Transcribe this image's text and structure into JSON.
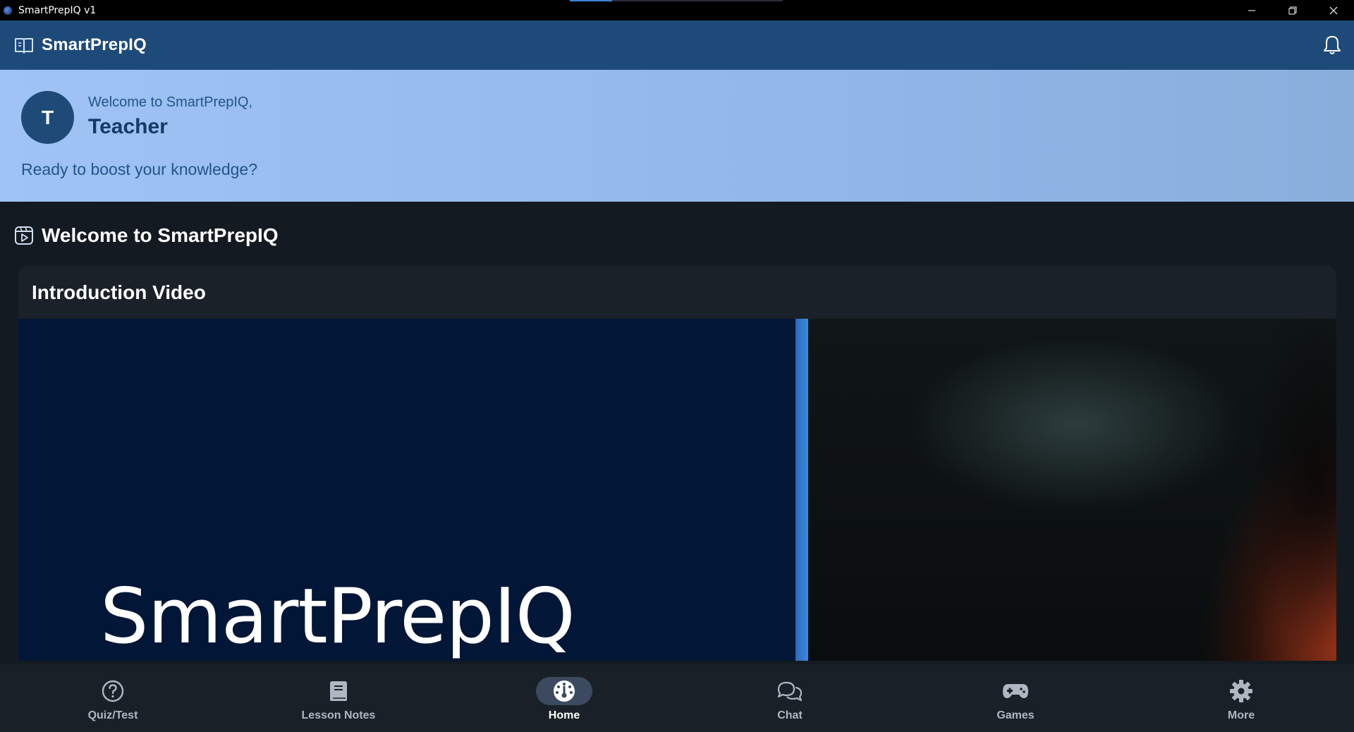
{
  "window": {
    "title": "SmartPrepIQ v1"
  },
  "header": {
    "brand": "SmartPrepIQ",
    "logo_icon": "book-open-icon",
    "notification_icon": "bell-icon"
  },
  "banner": {
    "avatar_initial": "T",
    "welcome_line": "Welcome to SmartPrepIQ,",
    "user_name": "Teacher",
    "tagline": "Ready to boost your knowledge?"
  },
  "section": {
    "icon": "video-icon",
    "title": "Welcome to SmartPrepIQ"
  },
  "card": {
    "title": "Introduction Video",
    "video_wordmark": "SmartPrepIQ"
  },
  "bottom_nav": {
    "items": [
      {
        "label": "Quiz/Test",
        "icon": "question-circle-icon",
        "active": false
      },
      {
        "label": "Lesson Notes",
        "icon": "book-icon",
        "active": false
      },
      {
        "label": "Home",
        "icon": "dashboard-gauge-icon",
        "active": true
      },
      {
        "label": "Chat",
        "icon": "chat-bubbles-icon",
        "active": false
      },
      {
        "label": "Games",
        "icon": "gamepad-icon",
        "active": false
      },
      {
        "label": "More",
        "icon": "gear-icon",
        "active": false
      }
    ]
  },
  "colors": {
    "header_bg": "#1e4a7a",
    "banner_bg": "#9fc3f5",
    "page_bg": "#141a21",
    "nav_bg": "#1a2027",
    "accent": "#3b8ae0"
  }
}
